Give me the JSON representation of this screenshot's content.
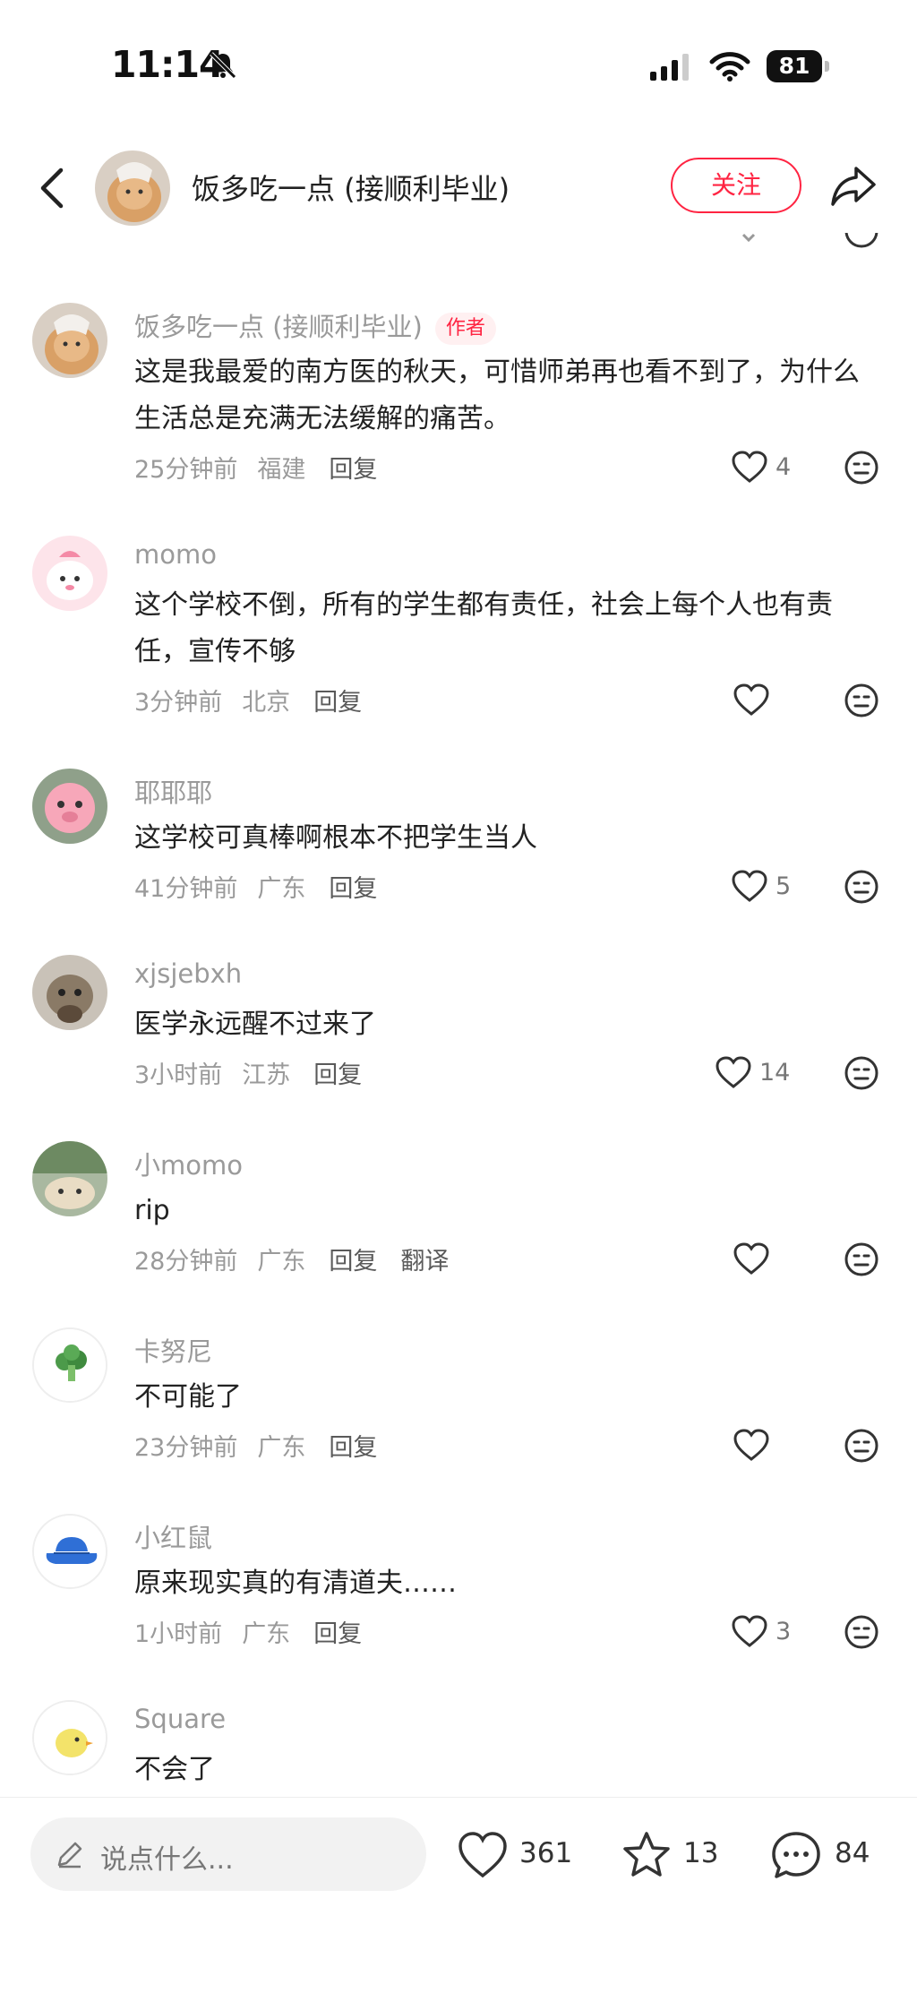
{
  "status_bar": {
    "time": "11:14",
    "battery": "81"
  },
  "header": {
    "title": "饭多吃一点 (接顺利毕业)",
    "follow_label": "关注"
  },
  "comments": [
    {
      "user": "饭多吃一点 (接顺利毕业)",
      "badge": "作者",
      "text": "这是我最爱的南方医的秋天，可惜师弟再也看不到了，为什么生活总是充满无法缓解的痛苦。",
      "time": "25分钟前",
      "location": "福建",
      "reply": "回复",
      "likes": "4"
    },
    {
      "user": "momo",
      "text": "这个学校不倒，所有的学生都有责任，社会上每个人也有责任，宣传不够",
      "time": "3分钟前",
      "location": "北京",
      "reply": "回复",
      "likes": ""
    },
    {
      "user": "耶耶耶",
      "text": "这学校可真棒啊根本不把学生当人",
      "time": "41分钟前",
      "location": "广东",
      "reply": "回复",
      "likes": "5"
    },
    {
      "user": "xjsjebxh",
      "text": "医学永远醒不过来了",
      "time": "3小时前",
      "location": "江苏",
      "reply": "回复",
      "likes": "14"
    },
    {
      "user": "小momo",
      "text": "rip",
      "time": "28分钟前",
      "location": "广东",
      "reply": "回复",
      "translate": "翻译",
      "likes": ""
    },
    {
      "user": "卡努尼",
      "text": "不可能了",
      "time": "23分钟前",
      "location": "广东",
      "reply": "回复",
      "likes": ""
    },
    {
      "user": "小红鼠",
      "text": "原来现实真的有清道夫……",
      "time": "1小时前",
      "location": "广东",
      "reply": "回复",
      "likes": "3"
    },
    {
      "user": "Square",
      "text": "不会了"
    }
  ],
  "bottom_bar": {
    "placeholder": "说点什么...",
    "likes": "361",
    "stars": "13",
    "comments": "84"
  },
  "icons": [
    "back-icon",
    "share-icon",
    "heart-icon",
    "emoji-icon",
    "pencil-icon",
    "star-icon",
    "comment-bubble-icon"
  ],
  "colors": {
    "accent": "#ff2442",
    "meta_gray": "#9a9a9a"
  }
}
